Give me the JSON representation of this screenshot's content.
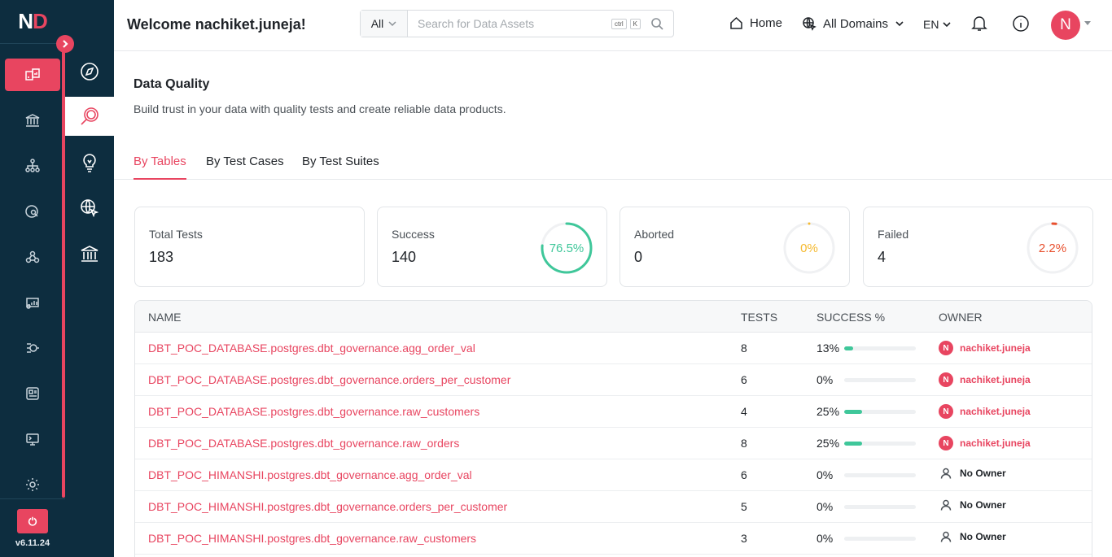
{
  "app": {
    "logo_n": "N",
    "logo_d": "D",
    "version": "v6.11.24"
  },
  "header": {
    "welcome": "Welcome nachiket.juneja!",
    "search_scope": "All",
    "search_placeholder": "Search for Data Assets",
    "kbd_ctrl": "ctrl",
    "kbd_k": "K",
    "home_label": "Home",
    "domains_label": "All Domains",
    "language": "EN",
    "avatar_initial": "N"
  },
  "page": {
    "title": "Data Quality",
    "description": "Build trust in your data with quality tests and create reliable data products."
  },
  "tabs": [
    {
      "label": "By Tables",
      "active": true
    },
    {
      "label": "By Test Cases",
      "active": false
    },
    {
      "label": "By Test Suites",
      "active": false
    }
  ],
  "summary": {
    "total": {
      "label": "Total Tests",
      "value": "183"
    },
    "success": {
      "label": "Success",
      "value": "140",
      "percent_text": "76.5%",
      "percent": 76.5,
      "color": "#3fc79a"
    },
    "aborted": {
      "label": "Aborted",
      "value": "0",
      "percent_text": "0%",
      "percent": 0,
      "color": "#f5b92e"
    },
    "failed": {
      "label": "Failed",
      "value": "4",
      "percent_text": "2.2%",
      "percent": 2.2,
      "color": "#e8502e"
    }
  },
  "table": {
    "columns": [
      "Name",
      "Tests",
      "Success %",
      "Owner"
    ],
    "rows": [
      {
        "name": "DBT_POC_DATABASE.postgres.dbt_governance.agg_order_val",
        "tests": "8",
        "success_text": "13%",
        "success": 13,
        "owner": "nachiket.juneja",
        "has_owner": true
      },
      {
        "name": "DBT_POC_DATABASE.postgres.dbt_governance.orders_per_customer",
        "tests": "6",
        "success_text": "0%",
        "success": 0,
        "owner": "nachiket.juneja",
        "has_owner": true
      },
      {
        "name": "DBT_POC_DATABASE.postgres.dbt_governance.raw_customers",
        "tests": "4",
        "success_text": "25%",
        "success": 25,
        "owner": "nachiket.juneja",
        "has_owner": true
      },
      {
        "name": "DBT_POC_DATABASE.postgres.dbt_governance.raw_orders",
        "tests": "8",
        "success_text": "25%",
        "success": 25,
        "owner": "nachiket.juneja",
        "has_owner": true
      },
      {
        "name": "DBT_POC_HIMANSHI.postgres.dbt_governance.agg_order_val",
        "tests": "6",
        "success_text": "0%",
        "success": 0,
        "owner": "No Owner",
        "has_owner": false
      },
      {
        "name": "DBT_POC_HIMANSHI.postgres.dbt_governance.orders_per_customer",
        "tests": "5",
        "success_text": "0%",
        "success": 0,
        "owner": "No Owner",
        "has_owner": false
      },
      {
        "name": "DBT_POC_HIMANSHI.postgres.dbt_governance.raw_customers",
        "tests": "3",
        "success_text": "0%",
        "success": 0,
        "owner": "No Owner",
        "has_owner": false
      }
    ]
  },
  "colors": {
    "accent": "#e84560",
    "sidebar": "#0d2d3f",
    "success": "#3fc79a"
  }
}
